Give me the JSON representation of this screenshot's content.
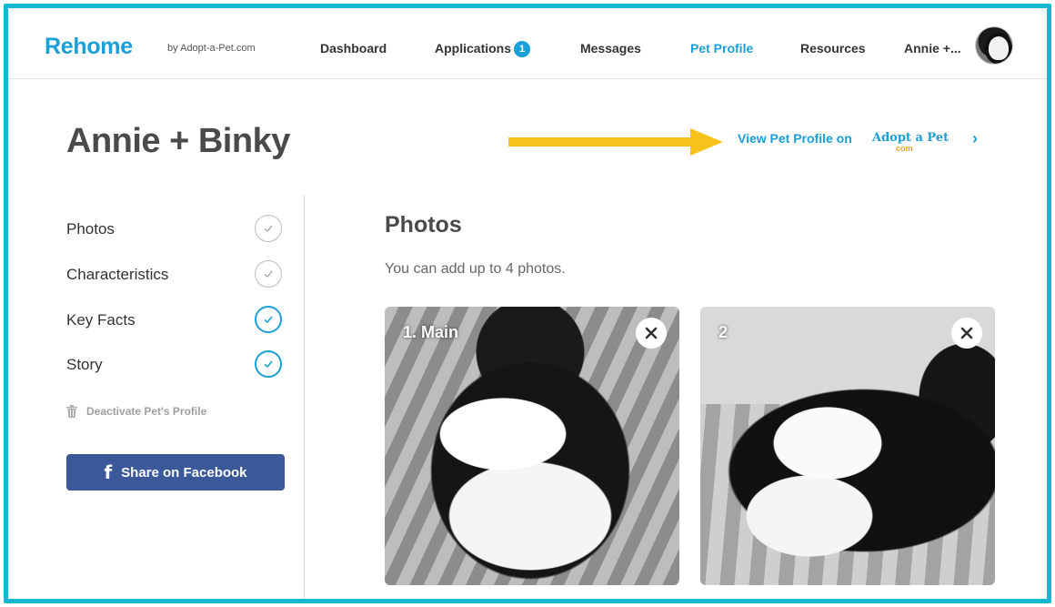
{
  "header": {
    "brand": "Rehome",
    "brand_sub": "by Adopt-a-Pet.com",
    "nav": {
      "dashboard": "Dashboard",
      "applications": "Applications",
      "applications_badge": "1",
      "messages": "Messages",
      "pet_profile": "Pet Profile",
      "resources": "Resources",
      "user": "Annie +..."
    }
  },
  "page": {
    "title": "Annie + Binky",
    "view_link": "View Pet Profile on",
    "logo_main": "Adopt a Pet",
    "logo_sub": "com",
    "view_chevron": "›"
  },
  "sidebar": {
    "items": [
      {
        "label": "Photos",
        "complete": false
      },
      {
        "label": "Characteristics",
        "complete": false
      },
      {
        "label": "Key Facts",
        "complete": true
      },
      {
        "label": "Story",
        "complete": true
      }
    ],
    "deactivate": "Deactivate Pet's Profile",
    "share": "Share on Facebook",
    "share_icon": "f"
  },
  "main": {
    "heading": "Photos",
    "subtitle": "You can add up to 4 photos.",
    "photos": [
      {
        "label": "1. Main"
      },
      {
        "label": "2"
      }
    ]
  },
  "colors": {
    "accent": "#1a9fd6",
    "frame": "#17b6d1",
    "facebook": "#3b5998",
    "arrow": "#f9c21b"
  }
}
